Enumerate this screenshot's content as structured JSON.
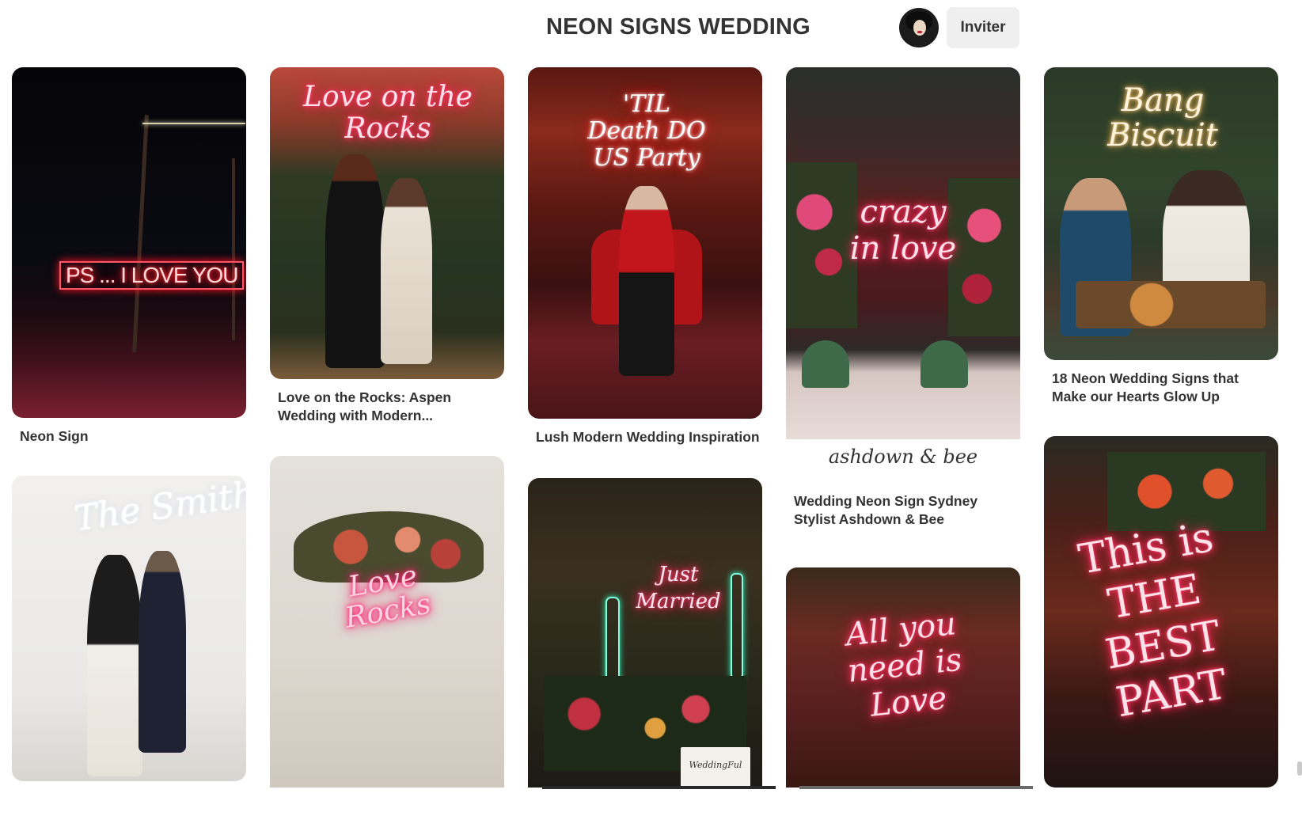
{
  "board": {
    "title": "NEON SIGNS WEDDING",
    "invite_label": "Inviter"
  },
  "pins": [
    {
      "caption": "Neon Sign",
      "neon_text": "PS ... I LOVE YOU"
    },
    {
      "caption": "Love on the Rocks: Aspen Wedding with Modern...",
      "neon_text": "Love on the Rocks"
    },
    {
      "caption": "Lush Modern Wedding Inspiration",
      "neon_text": "'TIL Death DO US Party"
    },
    {
      "caption": "Wedding Neon Sign Sydney Stylist Ashdown & Bee",
      "neon_text": "crazy in love",
      "watermark": "ashdown & bee"
    },
    {
      "caption": "18 Neon Wedding Signs that Make our Hearts Glow Up",
      "neon_text": "Bang Biscuit"
    },
    {
      "caption": "",
      "neon_text": "The Smiths"
    },
    {
      "caption": "",
      "neon_text": "Love Rocks"
    },
    {
      "caption": "",
      "neon_text": "Just Married",
      "watermark": "WeddingFul"
    },
    {
      "caption": "",
      "neon_text": "All you need is Love"
    },
    {
      "caption": "",
      "neon_text": "This is THE BEST PART"
    }
  ],
  "colors": {
    "invite_bg": "#efefef",
    "text": "#333333"
  }
}
